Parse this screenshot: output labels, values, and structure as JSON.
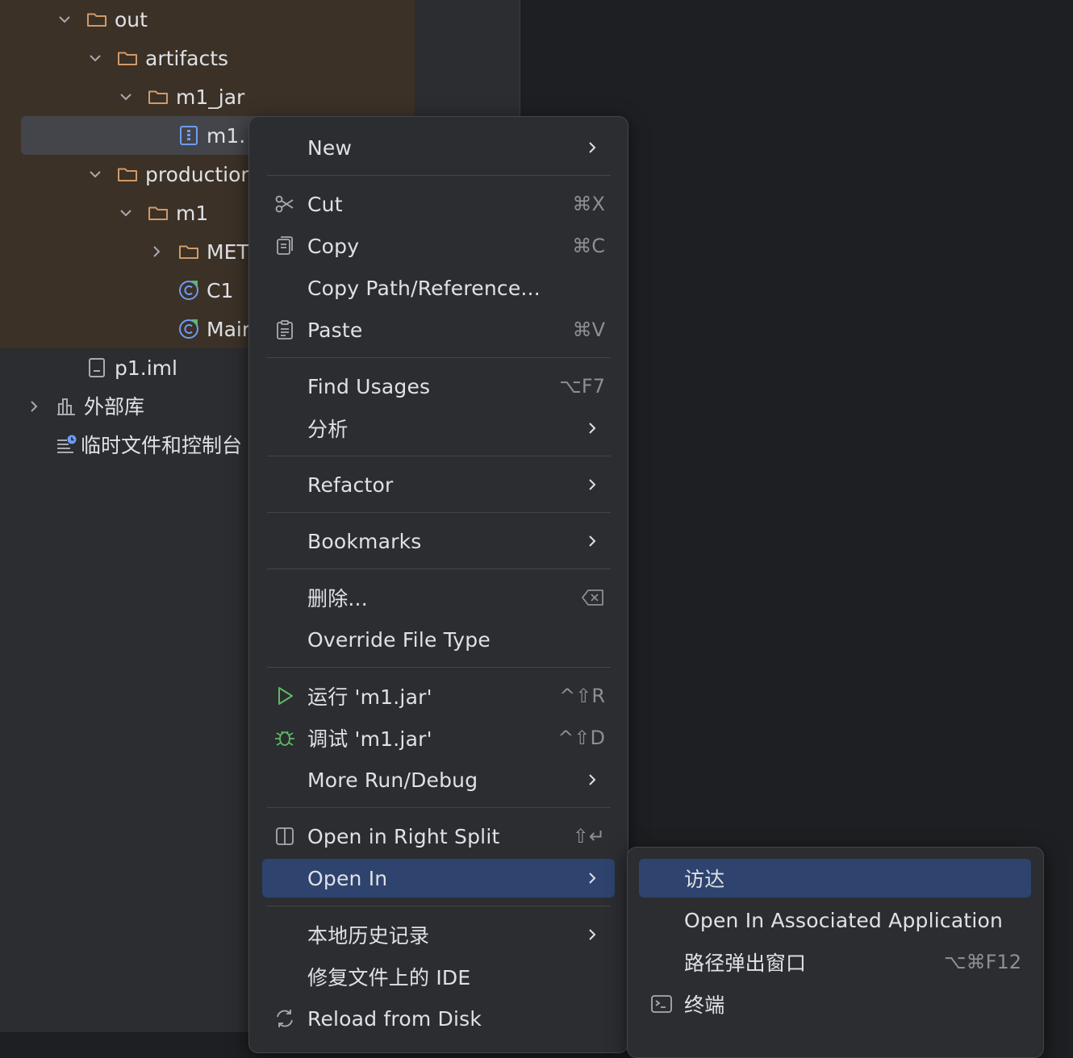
{
  "tree": {
    "items": [
      {
        "label": "out"
      },
      {
        "label": "artifacts"
      },
      {
        "label": "m1_jar"
      },
      {
        "label": "m1."
      },
      {
        "label": "productior"
      },
      {
        "label": "m1"
      },
      {
        "label": "MET"
      },
      {
        "label": "C1"
      },
      {
        "label": "Mair"
      },
      {
        "label": "p1.iml"
      },
      {
        "label": "外部库"
      },
      {
        "label": "临时文件和控制台"
      }
    ]
  },
  "context_menu": {
    "new": {
      "label": "New"
    },
    "cut": {
      "label": "Cut",
      "shortcut": "⌘X"
    },
    "copy": {
      "label": "Copy",
      "shortcut": "⌘C"
    },
    "copy_path": {
      "label": "Copy Path/Reference..."
    },
    "paste": {
      "label": "Paste",
      "shortcut": "⌘V"
    },
    "find_usages": {
      "label": "Find Usages",
      "shortcut": "⌥F7"
    },
    "analyze": {
      "label": "分析"
    },
    "refactor": {
      "label": "Refactor"
    },
    "bookmarks": {
      "label": "Bookmarks"
    },
    "delete": {
      "label": "删除..."
    },
    "override_file_type": {
      "label": "Override File Type"
    },
    "run": {
      "label": "运行 'm1.jar'",
      "shortcut": "^⇧R"
    },
    "debug": {
      "label": "调试 'm1.jar'",
      "shortcut": "^⇧D"
    },
    "more_run_debug": {
      "label": "More Run/Debug"
    },
    "open_right_split": {
      "label": "Open in Right Split",
      "shortcut": "⇧↵"
    },
    "open_in": {
      "label": "Open In"
    },
    "local_history": {
      "label": "本地历史记录"
    },
    "repair_ide": {
      "label": "修复文件上的 IDE"
    },
    "reload_from_disk": {
      "label": "Reload from Disk"
    }
  },
  "open_in_submenu": {
    "finder": {
      "label": "访达"
    },
    "associated_app": {
      "label": "Open In Associated Application"
    },
    "path_popup": {
      "label": "路径弹出窗口",
      "shortcut": "⌥⌘F12"
    },
    "terminal": {
      "label": "终端"
    }
  },
  "colors": {
    "background": "#1e1f22",
    "panel": "#2b2d30",
    "selection": "#2e436e",
    "folder_icon": "#d19a66",
    "run_icon": "#5fb865"
  }
}
